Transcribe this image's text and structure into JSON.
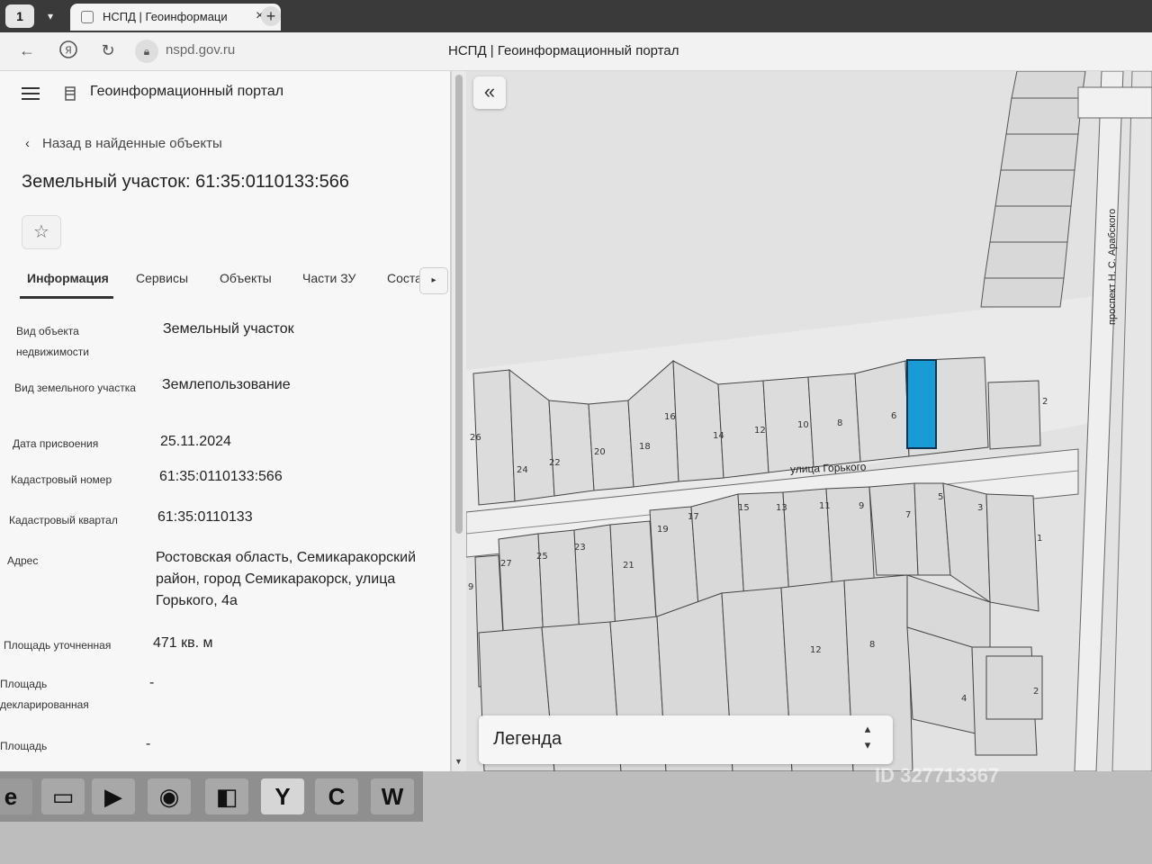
{
  "browser": {
    "tab_title": "НСПД | Геоинформаци",
    "address": "nspd.gov.ru",
    "page_heading": "НСПД | Геоинформационный портал",
    "app_button": "1",
    "icons": [
      "back-arrow-icon",
      "yandex-icon",
      "reload-icon",
      "lock-icon"
    ]
  },
  "panel": {
    "portal_title": "Геоинформационный портал",
    "back_link": "Назад в найденные объекты",
    "object_title": "Земельный участок: 61:35:0110133:566",
    "tabs": [
      "Информация",
      "Сервисы",
      "Объекты",
      "Части ЗУ",
      "Соста"
    ],
    "fields": [
      {
        "label": "Вид объекта недвижимости",
        "value": "Земельный участок"
      },
      {
        "label": "Вид земельного участка",
        "value": "Землепользование"
      },
      {
        "label": "Дата присвоения",
        "value": "25.11.2024"
      },
      {
        "label": "Кадастровый номер",
        "value": "61:35:0110133:566"
      },
      {
        "label": "Кадастровый квартал",
        "value": "61:35:0110133"
      },
      {
        "label": "Адрес",
        "value": "Ростовская область, Семикаракорский район, город Семикаракорск, улица Горького, 4а"
      },
      {
        "label": "Площадь уточненная",
        "value": "471 кв. м"
      },
      {
        "label": "Площадь декларированная",
        "value": "-"
      },
      {
        "label": "Площадь",
        "value": "-"
      }
    ]
  },
  "map": {
    "street_gorky": "улица Горького",
    "street_arabsky": "проспект Н. С. Арабского",
    "legend": "Легенда",
    "selected_color": "#1a9bd7",
    "parcel_numbers_north": [
      "26",
      "24",
      "22",
      "20",
      "18",
      "16",
      "14",
      "12",
      "10",
      "8",
      "6",
      "2"
    ],
    "parcel_numbers_south": [
      "27",
      "25",
      "23",
      "21",
      "19",
      "17",
      "15",
      "13",
      "11",
      "9",
      "7",
      "5",
      "3",
      "1",
      "12",
      "8",
      "4",
      "2",
      "9"
    ]
  },
  "taskbar": {
    "watermark": "ID 327713367",
    "apps": [
      "edge-icon",
      "explorer-icon",
      "media-icon",
      "chrome-icon",
      "files-icon",
      "yandex-browser-icon",
      "ccleaner-icon",
      "word-icon"
    ]
  }
}
